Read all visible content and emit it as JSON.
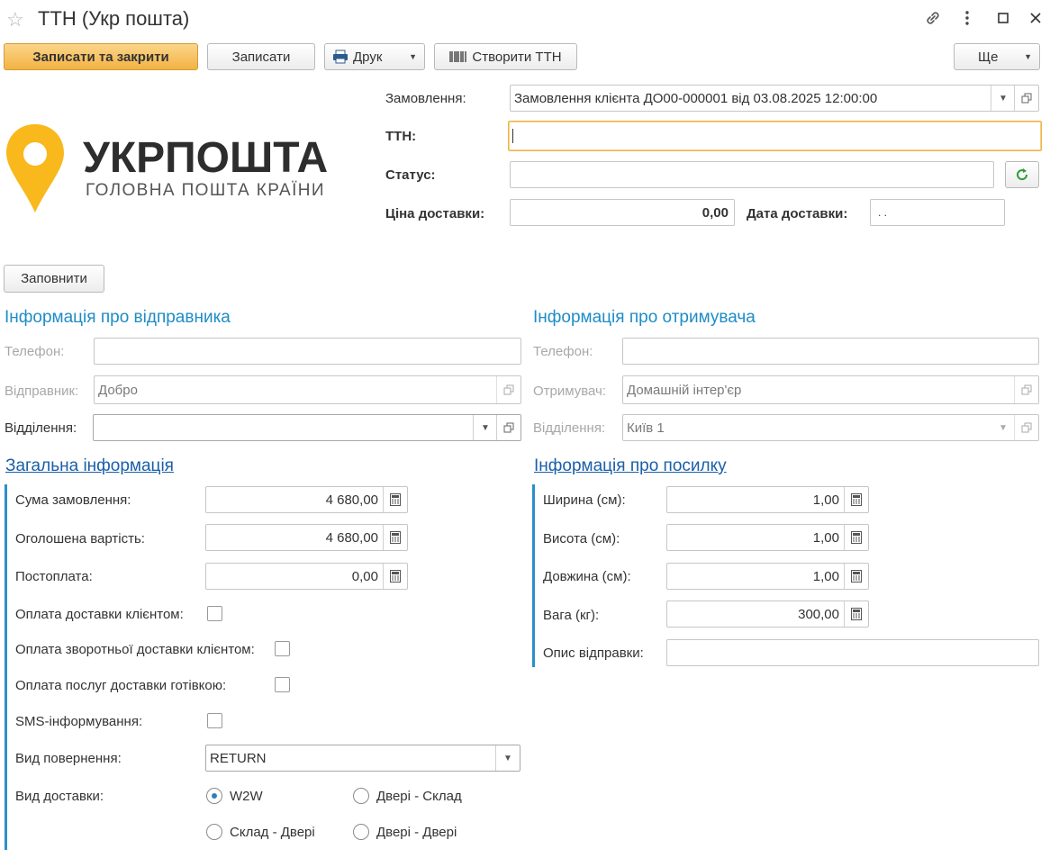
{
  "window": {
    "title": "ТТН (Укр пошта)",
    "star_icon": "star-icon",
    "link_icon": "link-icon",
    "more_icon": "more-vertical-icon",
    "maximize_icon": "maximize-icon",
    "close_icon": "close-icon"
  },
  "toolbar": {
    "save_close": "Записати та закрити",
    "save": "Записати",
    "print": "Друк",
    "create_ttn": "Створити ТТН",
    "more": "Ще"
  },
  "logo": {
    "brand": "УКРПОШТА",
    "tagline": "ГОЛОВНА ПОШТА КРАЇНИ",
    "color": "#f9b81b"
  },
  "header": {
    "order_label": "Замовлення:",
    "order_value": "Замовлення клієнта ДО00-000001 від 03.08.2025 12:00:00",
    "ttn_label": "ТТН:",
    "ttn_value": "",
    "status_label": "Статус:",
    "status_value": "",
    "price_label": "Ціна доставки:",
    "price_value": "0,00",
    "date_label": "Дата доставки:",
    "date_value": ". ."
  },
  "fill_button": "Заповнити",
  "sender": {
    "title": "Інформація про відправника",
    "phone_label": "Телефон:",
    "phone_value": "",
    "sender_label": "Відправник:",
    "sender_value": "Добро",
    "branch_label": "Відділення:",
    "branch_value": ""
  },
  "recipient": {
    "title": "Інформація про отримувача",
    "phone_label": "Телефон:",
    "phone_value": "",
    "recipient_label": "Отримувач:",
    "recipient_value": "Домашній інтер'єр",
    "branch_label": "Відділення:",
    "branch_value": "Київ 1"
  },
  "general": {
    "title": "Загальна інформація",
    "order_sum_label": "Сума замовлення:",
    "order_sum_value": "4 680,00",
    "declared_label": "Оголошена вартість:",
    "declared_value": "4 680,00",
    "postpay_label": "Постоплата:",
    "postpay_value": "0,00",
    "pay_delivery_label": "Оплата доставки клієнтом:",
    "pay_return_label": "Оплата зворотньої доставки клієнтом:",
    "pay_cash_label": "Оплата послуг доставки готівкою:",
    "sms_label": "SMS-інформування:",
    "return_type_label": "Вид повернення:",
    "return_type_value": "RETURN",
    "delivery_type_label": "Вид доставки:",
    "delivery_options": [
      "W2W",
      "Двері - Склад",
      "Склад - Двері",
      "Двері - Двері"
    ],
    "delivery_selected": "W2W"
  },
  "parcel": {
    "title": "Інформація про посилку",
    "width_label": "Ширина (см):",
    "width_value": "1,00",
    "height_label": "Висота (см):",
    "height_value": "1,00",
    "length_label": "Довжина (см):",
    "length_value": "1,00",
    "weight_label": "Вага (кг):",
    "weight_value": "300,00",
    "desc_label": "Опис відправки:",
    "desc_value": ""
  }
}
